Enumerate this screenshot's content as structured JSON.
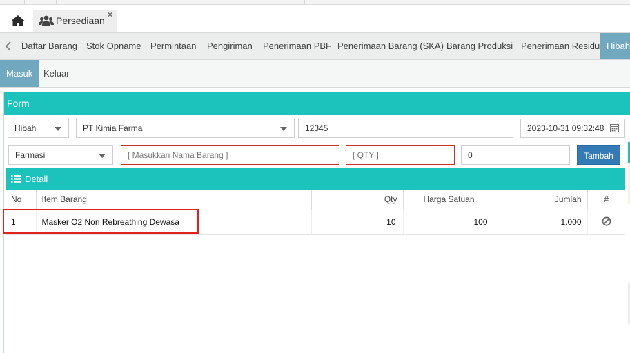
{
  "tabs": {
    "home_icon": "home-icon",
    "page_tab_label": "Persediaan",
    "page_tab_icon": "users-icon",
    "close_symbol": "×"
  },
  "menu": {
    "items": [
      "Daftar Barang",
      "Stok Opname",
      "Permintaan",
      "Pengiriman",
      "Penerimaan PBF",
      "Penerimaan Barang (SKA)",
      "Barang Produksi",
      "Penerimaan Residu",
      "Hibah"
    ],
    "active": "Hibah"
  },
  "submenu": {
    "items": [
      "Masuk",
      "Keluar"
    ],
    "active": "Masuk"
  },
  "form": {
    "title": "Form",
    "type_select": "Hibah",
    "supplier_select": "PT Kimia Farma",
    "doc_number": "12345",
    "datetime": "2023-10-31 09:32:48",
    "category_select": "Farmasi",
    "item_placeholder": "[ Masukkan Nama Barang ]",
    "qty_placeholder": "[ QTY ]",
    "price_value": "0",
    "add_button": "Tambah"
  },
  "detail": {
    "title": "Detail",
    "columns": {
      "no": "No",
      "item": "Item Barang",
      "qty": "Qty",
      "price": "Harga Satuan",
      "total": "Jumlah",
      "action": "#"
    },
    "rows": [
      {
        "no": "1",
        "item": "Masker O2 Non Rebreathing Dewasa",
        "qty": "10",
        "price": "100",
        "total": "1.000",
        "action_icon": "ban-icon"
      }
    ]
  },
  "colors": {
    "teal": "#1cc3bd",
    "active_tab": "#6fa8bf",
    "primary_button": "#337ab7",
    "highlight": "#e0201d"
  }
}
